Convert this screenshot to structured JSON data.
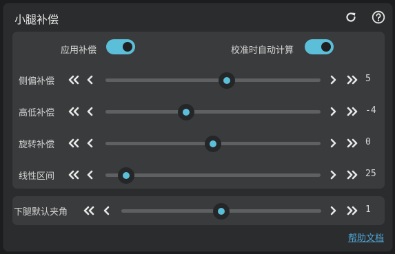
{
  "header": {
    "title": "小腿补偿"
  },
  "toggles": [
    {
      "label": "应用补偿",
      "on": true
    },
    {
      "label": "校准时自动计算",
      "on": true
    }
  ],
  "sliders": [
    {
      "label": "侧偏补偿",
      "value": "5",
      "position": 0.565
    },
    {
      "label": "高低补偿",
      "value": "-4",
      "position": 0.375
    },
    {
      "label": "旋转补偿",
      "value": "0",
      "position": 0.5
    },
    {
      "label": "线性区间",
      "value": "25",
      "position": 0.095
    }
  ],
  "lower": {
    "label": "下腿默认夹角",
    "value": "1",
    "position": 0.5
  },
  "footer": {
    "help_link": "帮助文档"
  },
  "colors": {
    "accent": "#5bbfd9",
    "panel": "#2b2c2d",
    "card": "#3a3b3c",
    "link": "#4fa6d6"
  }
}
